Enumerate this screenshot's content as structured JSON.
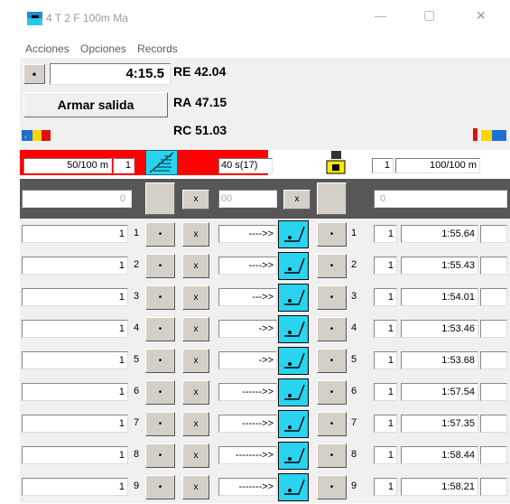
{
  "window": {
    "title": "4 T 2  F 100m Ma",
    "minimize": "—",
    "maximize": "▢",
    "close": "✕"
  },
  "menu": [
    "Acciones",
    "Opciones",
    "Records"
  ],
  "panel": {
    "dot": "•",
    "time": "4:15.5",
    "armar": "Armar salida",
    "records": [
      {
        "label": "RE",
        "value": "42.04"
      },
      {
        "label": "RA",
        "value": "47.15"
      },
      {
        "label": "RC",
        "value": "51.03"
      }
    ]
  },
  "redbar": {
    "left_dist": "50/100 m",
    "left_num": "1",
    "center": "40 s(17)",
    "right_num": "1",
    "right_dist": "100/100 m"
  },
  "header": {
    "left_val": "0",
    "x1": "x",
    "mid": "00",
    "x2": "x",
    "right_val": "0"
  },
  "rows": [
    {
      "lane": "1",
      "arrow": "---->>",
      "time": "1:55.64"
    },
    {
      "lane": "2",
      "arrow": "---->>",
      "time": "1:55.43"
    },
    {
      "lane": "3",
      "arrow": "--->>",
      "time": "1:54.01"
    },
    {
      "lane": "4",
      "arrow": "->>",
      "time": "1:53.46"
    },
    {
      "lane": "5",
      "arrow": "->>",
      "time": "1:53.68"
    },
    {
      "lane": "6",
      "arrow": "------>>",
      "time": "1:57.54"
    },
    {
      "lane": "7",
      "arrow": "------>>",
      "time": "1:57.35"
    },
    {
      "lane": "8",
      "arrow": "-------->>",
      "time": "1:58.44"
    },
    {
      "lane": "9",
      "arrow": "------->>",
      "time": "1:58.21"
    }
  ],
  "row_defaults": {
    "left_num": "1",
    "dot": "•",
    "x": "x",
    "right_num": "1"
  },
  "colors": {
    "red": "#ff0000",
    "cyan": "#2ad4ef",
    "yellow": "#ffe600",
    "dark": "#575757",
    "panel": "#f0f0f0"
  }
}
